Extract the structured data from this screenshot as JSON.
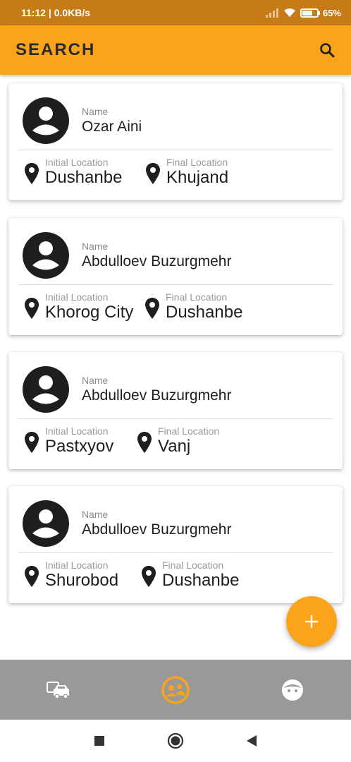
{
  "status_bar": {
    "time_speed": "11:12 | 0.0KB/s",
    "battery": "65%"
  },
  "app_bar": {
    "title": "SEARCH"
  },
  "colors": {
    "accent": "#fca31c",
    "status": "#c77b17",
    "nav_bg": "#999999"
  },
  "cards": [
    {
      "name_label": "Name",
      "name": "Ozar Aini",
      "initial_label": "Initial Location",
      "initial": "Dushanbe",
      "final_label": "Final Location",
      "final": "Khujand"
    },
    {
      "name_label": "Name",
      "name": "Abdulloev Buzurgmehr",
      "initial_label": "Initial Location",
      "initial": "Khorog City",
      "final_label": "Final Location",
      "final": "Dushanbe"
    },
    {
      "name_label": "Name",
      "name": "Abdulloev Buzurgmehr",
      "initial_label": "Initial Location",
      "initial": "Pastxyov",
      "final_label": "Final Location",
      "final": "Vanj"
    },
    {
      "name_label": "Name",
      "name": "Abdulloev Buzurgmehr",
      "initial_label": "Initial Location",
      "initial": "Shurobod",
      "final_label": "Final Location",
      "final": "Dushanbe"
    }
  ],
  "fab": {
    "icon": "plus-icon"
  },
  "bottom_nav": {
    "items": [
      "car-icon",
      "passenger-icon",
      "profile-icon"
    ],
    "active": 1
  },
  "system_nav": {
    "items": [
      "recents-icon",
      "home-icon",
      "back-icon"
    ]
  }
}
